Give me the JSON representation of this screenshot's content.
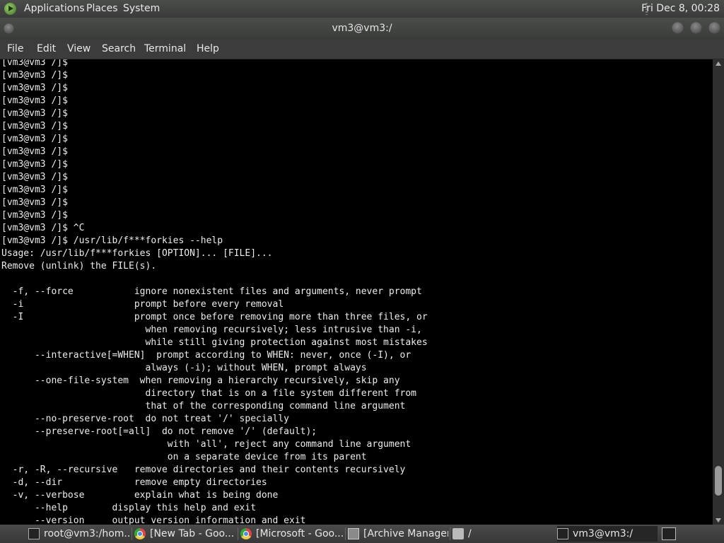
{
  "top_panel": {
    "menus": [
      "Applications",
      "Places",
      "System"
    ],
    "clock": "Fri Dec 8, 00:28"
  },
  "window": {
    "title": "vm3@vm3:/"
  },
  "menubar": [
    "File",
    "Edit",
    "View",
    "Search",
    "Terminal",
    "Help"
  ],
  "terminal": {
    "lines": [
      "[vm3@vm3 /]$",
      "[vm3@vm3 /]$",
      "[vm3@vm3 /]$",
      "[vm3@vm3 /]$",
      "[vm3@vm3 /]$",
      "[vm3@vm3 /]$",
      "[vm3@vm3 /]$",
      "[vm3@vm3 /]$",
      "[vm3@vm3 /]$",
      "[vm3@vm3 /]$",
      "[vm3@vm3 /]$",
      "[vm3@vm3 /]$",
      "[vm3@vm3 /]$",
      "[vm3@vm3 /]$ ^C",
      "[vm3@vm3 /]$ /usr/lib/f***forkies --help",
      "Usage: /usr/lib/f***forkies [OPTION]... [FILE]...",
      "Remove (unlink) the FILE(s).",
      "",
      "  -f, --force           ignore nonexistent files and arguments, never prompt",
      "  -i                    prompt before every removal",
      "  -I                    prompt once before removing more than three files, or",
      "                          when removing recursively; less intrusive than -i,",
      "                          while still giving protection against most mistakes",
      "      --interactive[=WHEN]  prompt according to WHEN: never, once (-I), or",
      "                          always (-i); without WHEN, prompt always",
      "      --one-file-system  when removing a hierarchy recursively, skip any",
      "                          directory that is on a file system different from",
      "                          that of the corresponding command line argument",
      "      --no-preserve-root  do not treat '/' specially",
      "      --preserve-root[=all]  do not remove '/' (default);",
      "                              with 'all', reject any command line argument",
      "                              on a separate device from its parent",
      "  -r, -R, --recursive   remove directories and their contents recursively",
      "  -d, --dir             remove empty directories",
      "  -v, --verbose         explain what is being done",
      "      --help        display this help and exit",
      "      --version     output version information and exit"
    ]
  },
  "taskbar": {
    "tasks": [
      {
        "label": "root@vm3:/hom...",
        "icon": "terminal-icon"
      },
      {
        "label": "[New Tab - Goo...",
        "icon": "chrome-icon"
      },
      {
        "label": "[Microsoft - Goo...",
        "icon": "chrome-icon"
      },
      {
        "label": "[Archive Manager]",
        "icon": "archive-icon"
      },
      {
        "label": "/",
        "icon": "folder-icon"
      },
      {
        "label": "vm3@vm3:/",
        "icon": "terminal-icon"
      }
    ]
  }
}
